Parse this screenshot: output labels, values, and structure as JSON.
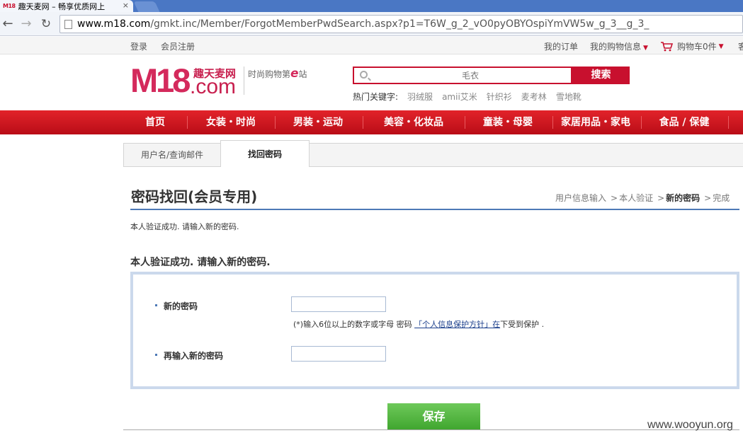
{
  "browser": {
    "tab_title": "趣天麦网 – 畅享优质网上",
    "tab_favicon": "M18",
    "close_glyph": "×",
    "url_host": "www.m18.com",
    "url_path": "/gmkt.inc/Member/ForgotMemberPwdSearch.aspx?p1=T6W_g_2_vO0pyOBYOspiYmVW5w_g_3__g_3_",
    "back_glyph": "←",
    "forward_glyph": "→",
    "reload_glyph": "↻"
  },
  "topbar": {
    "login": "登录",
    "register": "会员注册",
    "my_orders": "我的订单",
    "my_shopping_info": "我的购物信息",
    "cart": "购物车0件",
    "truncated": "客",
    "caret": "▼"
  },
  "logo": {
    "mark": "M18",
    "cn_name": "趣天麦网",
    "dotcom": ".com",
    "slogan_pre": "时尚购物第",
    "slogan_e": "e",
    "slogan_post": "站"
  },
  "search": {
    "placeholder": "毛衣",
    "button": "搜索",
    "hot_label": "热门关键字:",
    "hot_keywords": [
      "羽绒服",
      "amii艾米",
      "针织衫",
      "麦考林",
      "雪地靴"
    ]
  },
  "nav": {
    "items": [
      "首页",
      "女装・时尚",
      "男装・运动",
      "美容・化妆品",
      "童装・母婴",
      "家居用品・家电",
      "食品 / 保健"
    ]
  },
  "tabs": {
    "userid_search": "用户名/查询邮件",
    "recover_password": "找回密码"
  },
  "page": {
    "title": "密码找回(会员专用)",
    "steps": [
      "用户信息输入",
      "本人验证",
      "新的密码",
      "完成"
    ],
    "step_arrow": ">",
    "notice_small": "本人验证成功. 请输入新的密码.",
    "section_title": "本人验证成功. 请输入新的密码."
  },
  "form": {
    "new_password_label": "新的密码",
    "confirm_password_label": "再输入新的密码",
    "hint_pre": "(*)输入6位以上的数字或字母 密码 ",
    "hint_link": "「个人信息保护方针」在",
    "hint_post": "下受到保护 .",
    "new_password_value": "",
    "confirm_password_value": ""
  },
  "actions": {
    "save": "保存"
  },
  "watermark": "www.wooyun.org",
  "colors": {
    "brand_red": "#c8102e",
    "logo_pink": "#d42a5c",
    "accent_blue": "#4d79b6",
    "save_green": "#4fb33d"
  }
}
